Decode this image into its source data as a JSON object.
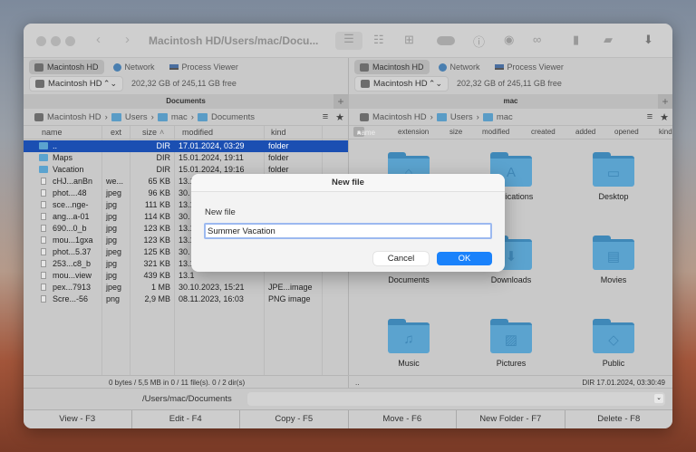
{
  "window": {
    "title": "Macintosh HD/Users/mac/Docu..."
  },
  "toolbar": {
    "icons": [
      "brief-view-icon",
      "list-view-icon",
      "thumbnail-view-icon",
      "toggle-icon",
      "info-icon",
      "preview-icon",
      "binoculars-icon",
      "archive-icon",
      "network-share-icon",
      "download-icon"
    ]
  },
  "drive_tabs": [
    "Macintosh HD",
    "Network",
    "Process Viewer"
  ],
  "left": {
    "drive": "Macintosh HD",
    "free": "202,32 GB of 245,11 GB free",
    "title": "Documents",
    "breadcrumb": [
      "Macintosh HD",
      "Users",
      "mac",
      "Documents"
    ],
    "columns": [
      "name",
      "ext",
      "size",
      "modified",
      "kind"
    ],
    "rows": [
      {
        "name": "..",
        "ext": "",
        "size": "DIR",
        "modified": "17.01.2024, 03:29",
        "kind": "folder",
        "type": "folder",
        "selected": true
      },
      {
        "name": "Maps",
        "ext": "",
        "size": "DIR",
        "modified": "15.01.2024, 19:11",
        "kind": "folder",
        "type": "folder"
      },
      {
        "name": "Vacation",
        "ext": "",
        "size": "DIR",
        "modified": "15.01.2024, 19:16",
        "kind": "folder",
        "type": "folder"
      },
      {
        "name": "cHJ...anBn",
        "ext": "we...",
        "size": "65 KB",
        "modified": "13.1",
        "kind": "",
        "type": "file"
      },
      {
        "name": "phot....48",
        "ext": "jpeg",
        "size": "96 KB",
        "modified": "30.",
        "kind": "",
        "type": "file"
      },
      {
        "name": "sce...nge-",
        "ext": "jpg",
        "size": "111 KB",
        "modified": "13.1",
        "kind": "",
        "type": "file"
      },
      {
        "name": "ang...a-01",
        "ext": "jpg",
        "size": "114 KB",
        "modified": "30.",
        "kind": "",
        "type": "file"
      },
      {
        "name": "690...0_b",
        "ext": "jpg",
        "size": "123 KB",
        "modified": "13.1",
        "kind": "",
        "type": "file"
      },
      {
        "name": "mou...1gxa",
        "ext": "jpg",
        "size": "123 KB",
        "modified": "13.1",
        "kind": "",
        "type": "file"
      },
      {
        "name": "phot...5.37",
        "ext": "jpeg",
        "size": "125 KB",
        "modified": "30.",
        "kind": "",
        "type": "file"
      },
      {
        "name": "253...c8_b",
        "ext": "jpg",
        "size": "321 KB",
        "modified": "13.1",
        "kind": "",
        "type": "file"
      },
      {
        "name": "mou...view",
        "ext": "jpg",
        "size": "439 KB",
        "modified": "13.1",
        "kind": "",
        "type": "file"
      },
      {
        "name": "pex...7913",
        "ext": "jpeg",
        "size": "1 MB",
        "modified": "30.10.2023, 15:21",
        "kind": "JPE...image",
        "type": "file"
      },
      {
        "name": "Scre...-56",
        "ext": "png",
        "size": "2,9 MB",
        "modified": "08.11.2023, 16:03",
        "kind": "PNG image",
        "type": "file"
      }
    ],
    "status": "0 bytes / 5,5 MB in 0 / 11 file(s). 0 / 2 dir(s)"
  },
  "right": {
    "drive": "Macintosh HD",
    "free": "202,32 GB of 245,11 GB free",
    "title": "mac",
    "breadcrumb": [
      "Macintosh HD",
      "Users",
      "mac"
    ],
    "columns": [
      "name",
      "extension",
      "size",
      "modified",
      "created",
      "added",
      "opened",
      "kind"
    ],
    "items": [
      {
        "label": "",
        "glyph": "⌂"
      },
      {
        "label": "Applications",
        "glyph": "A"
      },
      {
        "label": "Desktop",
        "glyph": "▭"
      },
      {
        "label": "Documents",
        "glyph": ""
      },
      {
        "label": "Downloads",
        "glyph": "⬇"
      },
      {
        "label": "Movies",
        "glyph": "▤"
      },
      {
        "label": "Music",
        "glyph": "♫"
      },
      {
        "label": "Pictures",
        "glyph": "▨"
      },
      {
        "label": "Public",
        "glyph": "◇"
      }
    ],
    "status_name": "..",
    "status_info": "DIR  17.01.2024, 03:30:49"
  },
  "path": "/Users/mac/Documents",
  "commands": [
    "View - F3",
    "Edit - F4",
    "Copy - F5",
    "Move - F6",
    "New Folder - F7",
    "Delete - F8"
  ],
  "dialog": {
    "title": "New file",
    "label": "New file",
    "value": "Summer Vacation",
    "cancel": "Cancel",
    "ok": "OK"
  },
  "colors": {
    "selection": "#1b4fb2",
    "folder": "#5ba3cf",
    "ok_button": "#1a82fb"
  }
}
